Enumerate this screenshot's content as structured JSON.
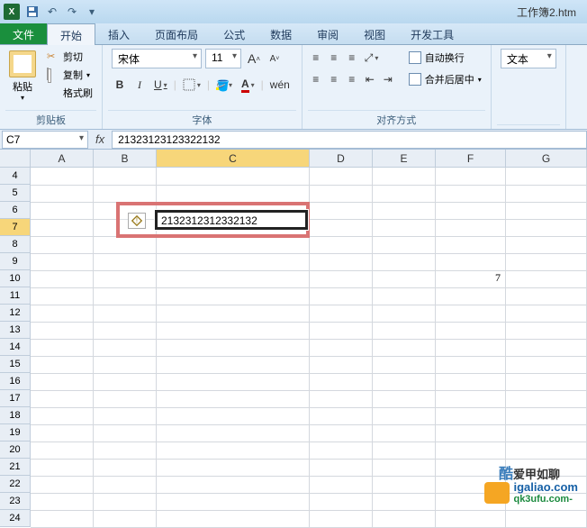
{
  "titlebar": {
    "app_title": "工作簿2.htm"
  },
  "tabs": {
    "file": "文件",
    "items": [
      "开始",
      "插入",
      "页面布局",
      "公式",
      "数据",
      "审阅",
      "视图",
      "开发工具"
    ],
    "active": 0
  },
  "ribbon": {
    "clipboard": {
      "paste": "粘贴",
      "cut": "剪切",
      "copy": "复制",
      "format_painter": "格式刷",
      "group_label": "剪贴板"
    },
    "font": {
      "name": "宋体",
      "size": "11",
      "group_label": "字体",
      "bold": "B",
      "italic": "I",
      "underline": "U",
      "grow": "A",
      "shrink": "A"
    },
    "alignment": {
      "wrap": "自动换行",
      "merge": "合并后居中",
      "group_label": "对齐方式"
    },
    "number": {
      "format": "文本"
    }
  },
  "formula_bar": {
    "name_box": "C7",
    "fx": "fx",
    "value": "21323123123322132"
  },
  "columns": [
    "A",
    "B",
    "C",
    "D",
    "E",
    "F",
    "G"
  ],
  "rows_start": 4,
  "rows_end": 24,
  "active_col": "C",
  "active_row": 7,
  "cells": {
    "C7": "2132312312332132",
    "F10": "7"
  },
  "watermark": {
    "line1": "爱甲如聊",
    "line2": "igaliao.com",
    "brand": "酷",
    "sub": "qk3ufu.com-"
  }
}
